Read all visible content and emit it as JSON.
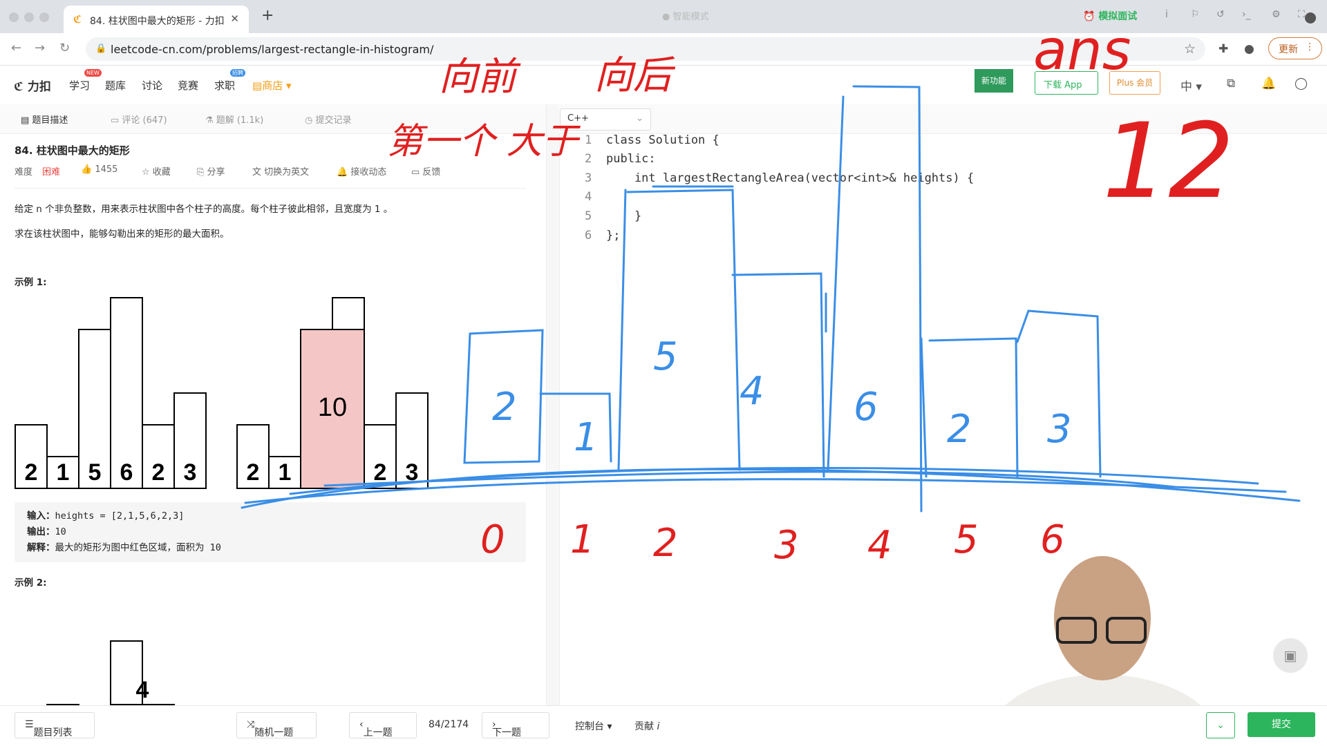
{
  "browser": {
    "tab_title": "84. 柱状图中最大的矩形 - 力扣",
    "favicon": "leetcode-icon",
    "url": "leetcode-cn.com/problems/largest-rectangle-in-histogram/",
    "update_label": "更新"
  },
  "header": {
    "logo": "力扣",
    "nav": [
      "学习",
      "题库",
      "讨论",
      "竞赛",
      "求职"
    ],
    "nav_badges": {
      "learn": "NEW",
      "jobs": "招聘"
    },
    "store": "商店",
    "new_feature": "新功能",
    "download_app": "下载 App",
    "plus": "Plus 会员",
    "lang": "中"
  },
  "left_tabs": {
    "description": "题目描述",
    "comments": "评论 (647)",
    "solutions": "题解 (1.1k)",
    "submissions": "提交记录"
  },
  "problem": {
    "title": "84. 柱状图中最大的矩形",
    "difficulty_label": "难度",
    "difficulty": "困难",
    "likes": "1455",
    "collect": "收藏",
    "share": "分享",
    "switch_lang": "切换为英文",
    "follow": "接收动态",
    "feedback": "反馈",
    "desc1": "给定 n 个非负整数，用来表示柱状图中各个柱子的高度。每个柱子彼此相邻，且宽度为 1 。",
    "desc2": "求在该柱状图中，能够勾勒出来的矩形的最大面积。",
    "example1_label": "示例 1:",
    "input_label": "输入：",
    "input_value": "heights = [2,1,5,6,2,3]",
    "output_label": "输出：",
    "output_value": "10",
    "explain_label": "解释：",
    "explain_value": "最大的矩形为图中红色区域，面积为 10",
    "example2_label": "示例 2:",
    "example1_heights": [
      2,
      1,
      5,
      6,
      2,
      3
    ],
    "example1_highlight": {
      "start": 2,
      "end": 3,
      "height": 5,
      "area_label": "10"
    },
    "example2_heights": [
      2,
      4
    ],
    "example2_highlight_label": "4"
  },
  "editor": {
    "language": "C++",
    "smart_mode": "智能模式",
    "mock_interview": "模拟面试",
    "line_numbers": [
      "1",
      "2",
      "3",
      "4",
      "5",
      "6"
    ],
    "lines": [
      "class Solution {",
      "public:",
      "    int largestRectangleArea(vector<int>& heights) {",
      "",
      "    }",
      "};"
    ]
  },
  "bottom": {
    "problem_list": "题目列表",
    "random": "随机一题",
    "prev": "上一题",
    "page": "84/2174",
    "next": "下一题",
    "console": "控制台",
    "contribute": "贡献",
    "submit": "提交"
  },
  "annotations": {
    "forward": "向前",
    "backward": "向后",
    "first_greater": "第一个 大于",
    "ans": "ans",
    "ans_value": "12",
    "bar_labels": [
      "2",
      "1",
      "5",
      "4",
      "6",
      "2",
      "3"
    ],
    "index_labels": [
      "0",
      "1",
      "2",
      "3",
      "4",
      "5",
      "6"
    ]
  },
  "colors": {
    "accent_green": "#2db55d",
    "hard_red": "#ef4743",
    "highlight_pink": "#f4c7c6",
    "ink_red": "#e02020",
    "ink_blue": "#3a8ee6"
  }
}
